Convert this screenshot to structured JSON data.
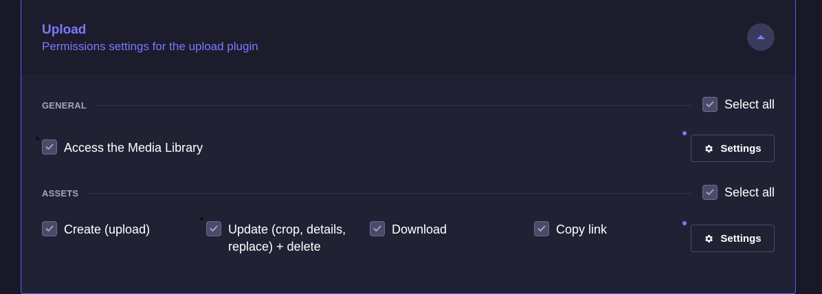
{
  "header": {
    "title": "Upload",
    "subtitle": "Permissions settings for the upload plugin",
    "collapse_icon": "chevron-up-icon"
  },
  "sections": {
    "general": {
      "label": "GENERAL",
      "select_all_label": "Select all",
      "select_all_checked": true,
      "permissions": [
        {
          "label": "Access the Media Library",
          "checked": true
        }
      ],
      "settings_button_label": "Settings"
    },
    "assets": {
      "label": "ASSETS",
      "select_all_label": "Select all",
      "select_all_checked": true,
      "permissions": [
        {
          "label": "Create (upload)",
          "checked": true
        },
        {
          "label": "Update (crop, details, replace) + delete",
          "checked": true
        },
        {
          "label": "Download",
          "checked": true
        },
        {
          "label": "Copy link",
          "checked": true
        }
      ],
      "settings_button_label": "Settings"
    }
  },
  "colors": {
    "accent": "#7b79ff",
    "panel_border": "#5e5bff",
    "background": "#181826"
  }
}
